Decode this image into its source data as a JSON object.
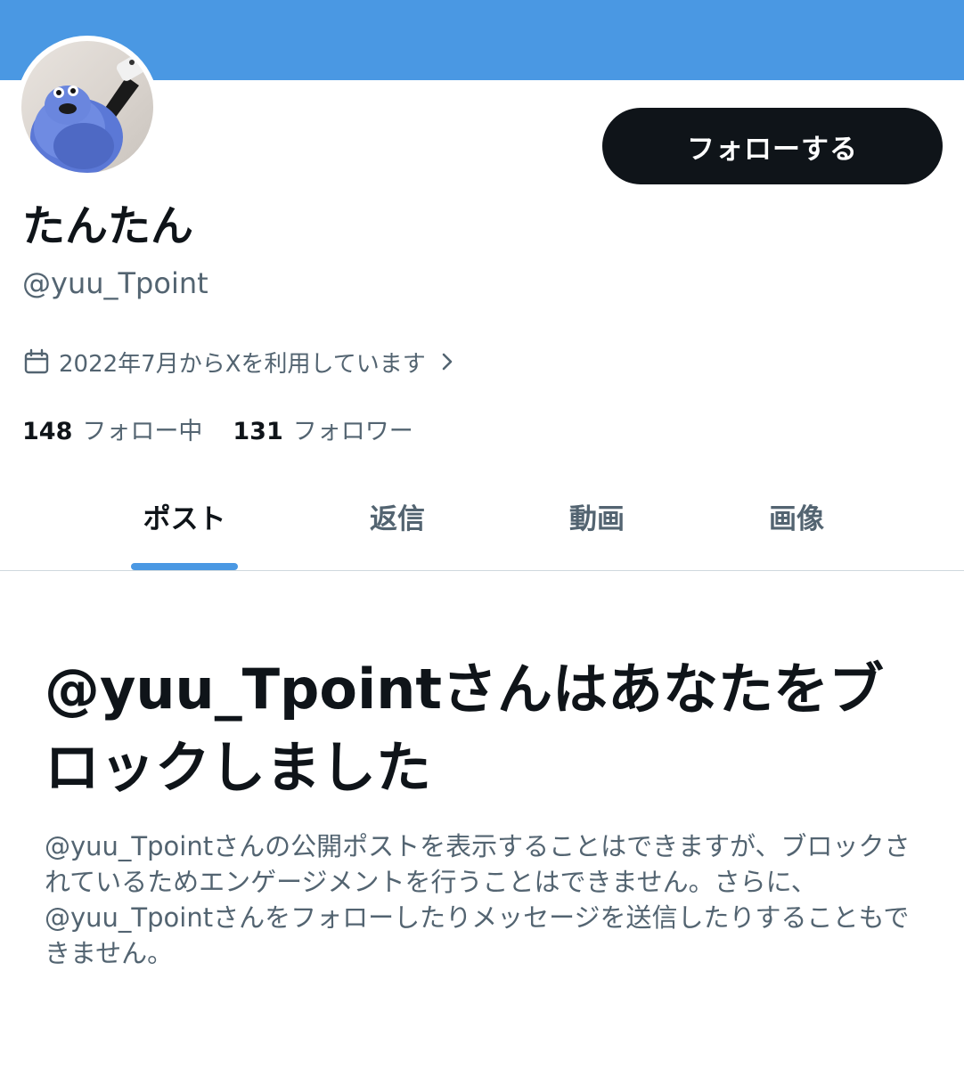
{
  "profile": {
    "display_name": "たんたん",
    "handle": "@yuu_Tpoint",
    "joined": "2022年7月からXを利用しています",
    "follow_button": "フォローする"
  },
  "stats": {
    "following_count": "148",
    "following_label": "フォロー中",
    "followers_count": "131",
    "followers_label": "フォロワー"
  },
  "tabs": [
    {
      "label": "ポスト",
      "active": true
    },
    {
      "label": "返信",
      "active": false
    },
    {
      "label": "動画",
      "active": false
    },
    {
      "label": "画像",
      "active": false
    }
  ],
  "block_notice": {
    "title": "@yuu_Tpointさんはあなたをブロックしました",
    "description": "@yuu_Tpointさんの公開ポストを表示することはできますが、ブロックされているためエンゲージメントを行うことはできません。さらに、@yuu_Tpointさんをフォローしたりメッセージを送信したりすることもできません。"
  },
  "colors": {
    "banner": "#4a98e3",
    "accent": "#4a98e3",
    "text_primary": "#0f1419",
    "text_secondary": "#536471"
  },
  "icons": {
    "joined": "calendar-icon",
    "joined_more": "chevron-right-icon"
  }
}
